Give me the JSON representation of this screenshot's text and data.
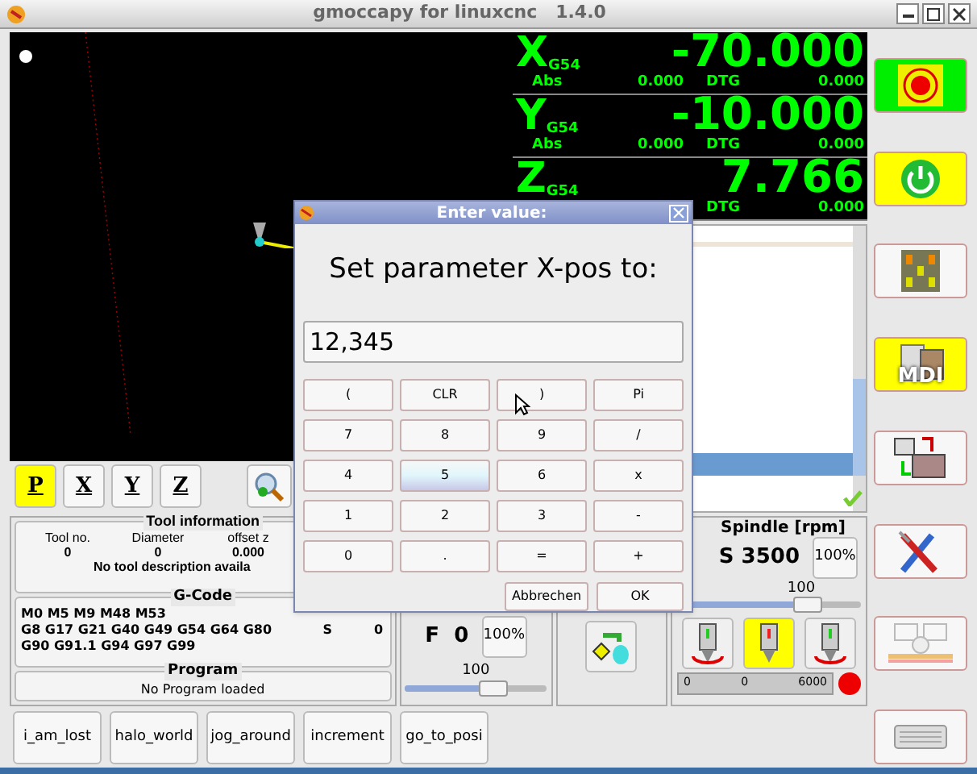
{
  "window": {
    "title": "gmoccapy for linuxcnc   1.4.0"
  },
  "dro": [
    {
      "axis": "X",
      "system": "G54",
      "value": "-70.000",
      "abs_label": "Abs",
      "abs": "0.000",
      "dtg_label": "DTG",
      "dtg": "0.000"
    },
    {
      "axis": "Y",
      "system": "G54",
      "value": "-10.000",
      "abs_label": "Abs",
      "abs": "0.000",
      "dtg_label": "DTG",
      "dtg": "0.000"
    },
    {
      "axis": "Z",
      "system": "G54",
      "value": "7.766",
      "dtg_label": "DTG",
      "dtg": "0.000"
    }
  ],
  "view_buttons": [
    {
      "label": "P",
      "selected": true
    },
    {
      "label": "X",
      "selected": false
    },
    {
      "label": "Y",
      "selected": false
    },
    {
      "label": "Z",
      "selected": false
    }
  ],
  "tool_info": {
    "title": "Tool information",
    "columns": [
      {
        "label": "Tool no.",
        "value": "0"
      },
      {
        "label": "Diameter",
        "value": "0"
      },
      {
        "label": "offset z",
        "value": "0.000"
      }
    ],
    "description": "No tool description availa"
  },
  "gcode": {
    "title": "G-Code",
    "lines": [
      "M0 M5 M9 M48 M53",
      "G8 G17 G21 G40 G49 G54 G64 G80",
      "G90 G91.1 G94 G97 G99"
    ],
    "s_label": "S",
    "s_value": "0"
  },
  "program": {
    "title": "Program",
    "text": "No Program loaded"
  },
  "feed": {
    "text": "F  0",
    "override": "100%",
    "slider_label": "100",
    "level": 0.62
  },
  "spindle": {
    "title": "Spindle [rpm]",
    "speed": "S 3500",
    "override": "100%",
    "slider_label": "100",
    "level": 0.7,
    "directions": [
      {
        "kind": "ccw",
        "selected": false
      },
      {
        "kind": "stop",
        "selected": true
      },
      {
        "kind": "cw",
        "selected": false
      }
    ],
    "bar_min": "0",
    "bar_value": "0",
    "bar_max": "6000",
    "at_speed": false
  },
  "macros": [
    "i_am_lost",
    "halo_world",
    "jog_around",
    "increment",
    "go_to_posi"
  ],
  "sidebar": [
    {
      "kind": "estop",
      "on": true
    },
    {
      "kind": "power",
      "on": true
    },
    {
      "kind": "manual",
      "on": false
    },
    {
      "kind": "mdi",
      "label": "MDI",
      "on": true
    },
    {
      "kind": "auto",
      "on": false
    },
    {
      "kind": "settings",
      "on": false
    },
    {
      "kind": "user",
      "on": false
    },
    {
      "kind": "keyboard",
      "on": false
    }
  ],
  "dialog": {
    "title": "Enter value:",
    "prompt": "Set parameter X-pos to:",
    "value": "12,345",
    "keys": [
      {
        "label": "(",
        "selected": false
      },
      {
        "label": "CLR",
        "selected": false
      },
      {
        "label": ")",
        "selected": false
      },
      {
        "label": "Pi",
        "selected": false
      },
      {
        "label": "7",
        "selected": false
      },
      {
        "label": "8",
        "selected": false
      },
      {
        "label": "9",
        "selected": false
      },
      {
        "label": "/",
        "selected": false
      },
      {
        "label": "4",
        "selected": false
      },
      {
        "label": "5",
        "selected": true
      },
      {
        "label": "6",
        "selected": false
      },
      {
        "label": "x",
        "selected": false
      },
      {
        "label": "1",
        "selected": false
      },
      {
        "label": "2",
        "selected": false
      },
      {
        "label": "3",
        "selected": false
      },
      {
        "label": "-",
        "selected": false
      },
      {
        "label": "0",
        "selected": false
      },
      {
        "label": ".",
        "selected": false
      },
      {
        "label": "=",
        "selected": false
      },
      {
        "label": "+",
        "selected": false
      }
    ],
    "buttons": [
      "Abbrechen",
      "OK"
    ]
  }
}
